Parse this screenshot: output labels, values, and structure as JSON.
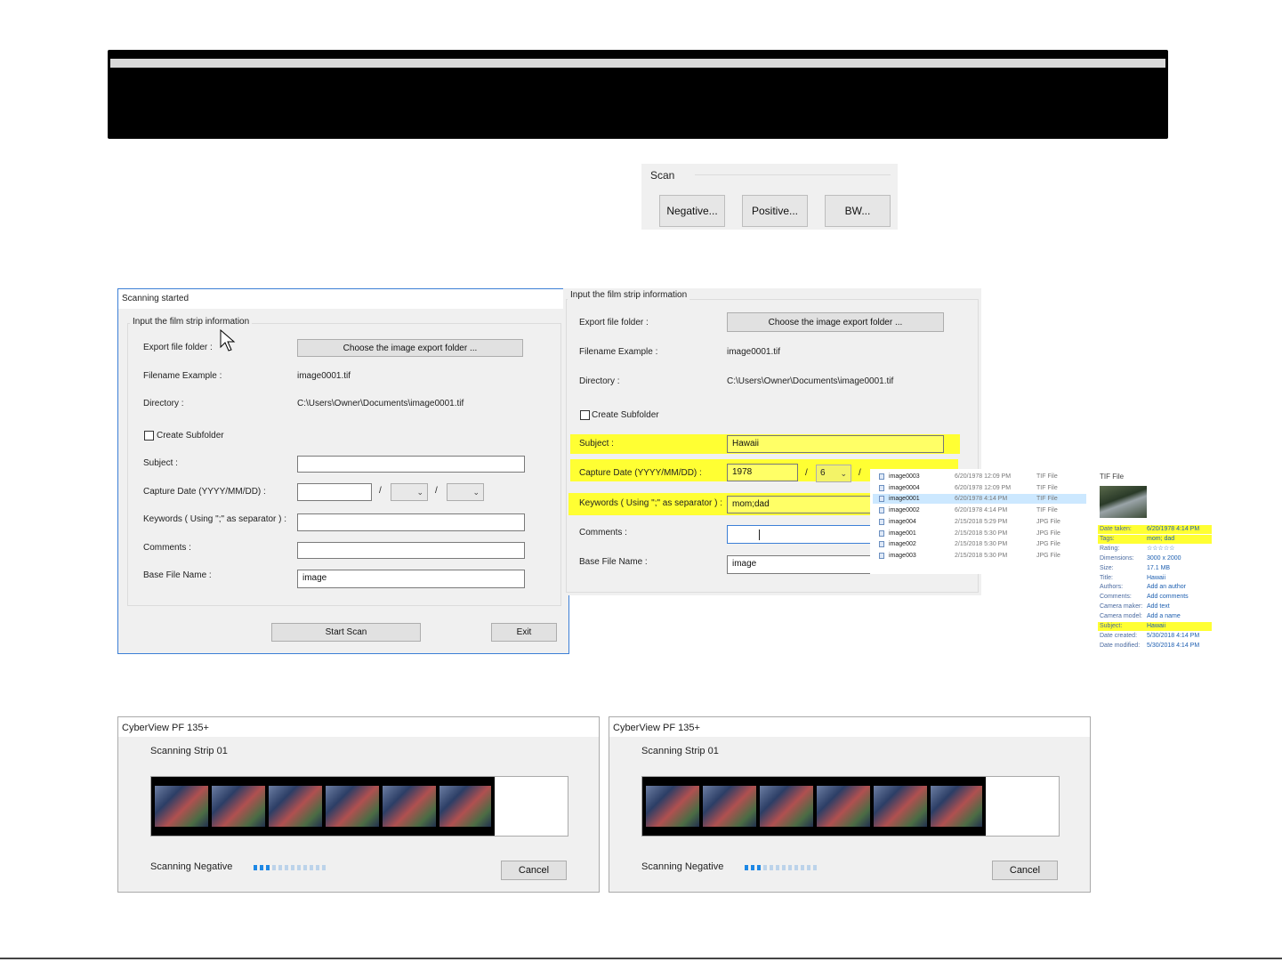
{
  "scan_group": {
    "title": "Scan",
    "buttons": [
      "Negative...",
      "Positive...",
      "BW..."
    ]
  },
  "dialog_left": {
    "title": "Scanning started",
    "group_title": "Input the film strip information",
    "export_label": "Export file folder :",
    "export_button": "Choose the image export folder ...",
    "filename_label": "Filename Example :",
    "filename_value": "image0001.tif",
    "directory_label": "Directory :",
    "directory_value": "C:\\Users\\Owner\\Documents\\image0001.tif",
    "subfolder_label": "Create Subfolder",
    "subject_label": "Subject :",
    "subject_value": "",
    "capture_label": "Capture Date (YYYY/MM/DD) :",
    "year_value": "",
    "sep": "/",
    "keywords_label": "Keywords ( Using \";\" as separator ) :",
    "keywords_value": "",
    "comments_label": "Comments :",
    "comments_value": "",
    "basename_label": "Base File Name :",
    "basename_value": "image",
    "start_button": "Start Scan",
    "exit_button": "Exit"
  },
  "dialog_right": {
    "group_title": "Input the film strip information",
    "export_label": "Export file folder :",
    "export_button": "Choose the image export folder ...",
    "filename_label": "Filename Example :",
    "filename_value": "image0001.tif",
    "directory_label": "Directory :",
    "directory_value": "C:\\Users\\Owner\\Documents\\image0001.tif",
    "subfolder_label": "Create Subfolder",
    "subject_label": "Subject :",
    "subject_value": "Hawaii",
    "capture_label": "Capture Date (YYYY/MM/DD) :",
    "year_value": "1978",
    "month_value": "6",
    "sep": "/",
    "keywords_label": "Keywords ( Using \";\" as separator ) :",
    "keywords_value": "mom;dad",
    "comments_label": "Comments :",
    "comments_value": "",
    "basename_label": "Base File Name :",
    "basename_value": "image",
    "highlight_color": "#ffff33"
  },
  "file_list": {
    "rows": [
      {
        "name": "image0003",
        "date": "6/20/1978 12:09 PM",
        "type": "TIF File"
      },
      {
        "name": "image0004",
        "date": "6/20/1978 12:09 PM",
        "type": "TIF File"
      },
      {
        "name": "image0001",
        "date": "6/20/1978 4:14 PM",
        "type": "TIF File"
      },
      {
        "name": "image0002",
        "date": "6/20/1978 4:14 PM",
        "type": "TIF File"
      },
      {
        "name": "image004",
        "date": "2/15/2018 5:29 PM",
        "type": "JPG File"
      },
      {
        "name": "image001",
        "date": "2/15/2018 5:30 PM",
        "type": "JPG File"
      },
      {
        "name": "image002",
        "date": "2/15/2018 5:30 PM",
        "type": "JPG File"
      },
      {
        "name": "image003",
        "date": "2/15/2018 5:30 PM",
        "type": "JPG File"
      }
    ],
    "selected_index": 2
  },
  "details": {
    "type": "TIF File",
    "fields": [
      {
        "k": "Date taken:",
        "v": "6/20/1978 4:14 PM",
        "hl": true
      },
      {
        "k": "Tags:",
        "v": "mom; dad",
        "hl": true
      },
      {
        "k": "Rating:",
        "v": "☆☆☆☆☆",
        "hl": false
      },
      {
        "k": "Dimensions:",
        "v": "3000 x 2000",
        "hl": false
      },
      {
        "k": "Size:",
        "v": "17.1 MB",
        "hl": false
      },
      {
        "k": "Title:",
        "v": "Hawaii",
        "hl": false
      },
      {
        "k": "Authors:",
        "v": "Add an author",
        "hl": false
      },
      {
        "k": "Comments:",
        "v": "Add comments",
        "hl": false
      },
      {
        "k": "Camera maker:",
        "v": "Add text",
        "hl": false
      },
      {
        "k": "Camera model:",
        "v": "Add a name",
        "hl": false
      },
      {
        "k": "Subject:",
        "v": "Hawaii",
        "hl": true
      },
      {
        "k": "Date created:",
        "v": "5/30/2018 4:14 PM",
        "hl": false
      },
      {
        "k": "Date modified:",
        "v": "5/30/2018 4:14 PM",
        "hl": false
      }
    ]
  },
  "scan_windows": [
    {
      "title": "CyberView PF 135+",
      "strip": "Scanning Strip 01",
      "status": "Scanning Negative",
      "cancel": "Cancel",
      "progress_filled": 3,
      "progress_total": 12
    },
    {
      "title": "CyberView PF 135+",
      "strip": "Scanning Strip 01",
      "status": "Scanning Negative",
      "cancel": "Cancel",
      "progress_filled": 3,
      "progress_total": 12
    }
  ],
  "colors": {
    "progress_on": "#1e88e5",
    "progress_off": "#bcd3ea"
  }
}
